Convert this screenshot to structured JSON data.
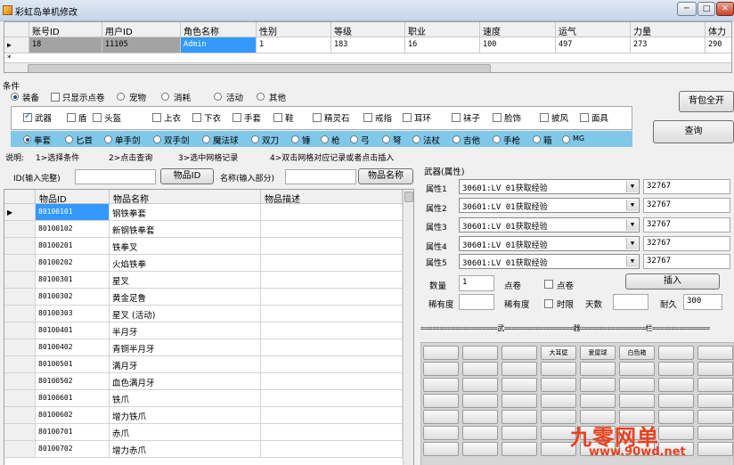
{
  "window": {
    "title": "彩虹岛单机修改",
    "min_glyph": "─",
    "max_glyph": "□",
    "close_glyph": "✕"
  },
  "top_grid": {
    "columns": [
      "账号ID",
      "用户ID",
      "角色名称",
      "性别",
      "等级",
      "职业",
      "速度",
      "运气",
      "力量",
      "体力"
    ],
    "row": [
      "18",
      "11105",
      "Admin",
      "1",
      "183",
      "16",
      "100",
      "497",
      "273",
      "290"
    ],
    "new_row_marker": "*",
    "current_row_marker": "▶"
  },
  "conditions": {
    "group_label": "条件",
    "radios": [
      {
        "label": "装备",
        "checked": true
      },
      {
        "label": "宠物",
        "checked": false
      },
      {
        "label": "消耗",
        "checked": false
      },
      {
        "label": "活动",
        "checked": false
      },
      {
        "label": "其他",
        "checked": false
      }
    ],
    "only_scroll": {
      "label": "只显示点卷",
      "checked": false
    },
    "equip_types": [
      {
        "label": "武器",
        "checked": true
      },
      {
        "label": "盾",
        "checked": false
      },
      {
        "label": "头盔",
        "checked": false
      },
      {
        "label": "上衣",
        "checked": false
      },
      {
        "label": "下衣",
        "checked": false
      },
      {
        "label": "手套",
        "checked": false
      },
      {
        "label": "鞋",
        "checked": false
      },
      {
        "label": "精灵石",
        "checked": false
      },
      {
        "label": "戒指",
        "checked": false
      },
      {
        "label": "耳环",
        "checked": false
      },
      {
        "label": "袜子",
        "checked": false
      },
      {
        "label": "脸饰",
        "checked": false
      },
      {
        "label": "披风",
        "checked": false
      },
      {
        "label": "面具",
        "checked": false
      }
    ],
    "weapon_types": [
      {
        "label": "拳套",
        "checked": true
      },
      {
        "label": "匕首",
        "checked": false
      },
      {
        "label": "单手剑",
        "checked": false
      },
      {
        "label": "双手剑",
        "checked": false
      },
      {
        "label": "魔法球",
        "checked": false
      },
      {
        "label": "双刀",
        "checked": false
      },
      {
        "label": "锤",
        "checked": false
      },
      {
        "label": "枪",
        "checked": false
      },
      {
        "label": "弓",
        "checked": false
      },
      {
        "label": "弩",
        "checked": false
      },
      {
        "label": "法杖",
        "checked": false
      },
      {
        "label": "吉他",
        "checked": false
      },
      {
        "label": "手枪",
        "checked": false
      },
      {
        "label": "箱",
        "checked": false
      },
      {
        "label": "MG",
        "checked": false
      }
    ],
    "unlock_bag_label": "背包全开",
    "query_label": "查询"
  },
  "instructions": {
    "label": "说明:",
    "step1": "1>选择条件",
    "step2": "2>点击查询",
    "step3": "3>选中网格记录",
    "step4": "4>双击网格对应记录或者点击插入"
  },
  "search": {
    "id_label": "ID(输入完整)",
    "id_value": "",
    "id_button": "物品ID",
    "name_label": "名称(输入部分)",
    "name_value": "",
    "name_button": "物品名称"
  },
  "item_grid": {
    "columns": [
      "物品ID",
      "物品名称",
      "物品描述"
    ],
    "rows": [
      {
        "id": "80100101",
        "name": "钢铁拳套",
        "desc": ""
      },
      {
        "id": "80100102",
        "name": "新钢铁拳套",
        "desc": ""
      },
      {
        "id": "80100201",
        "name": "铁拳叉",
        "desc": ""
      },
      {
        "id": "80100202",
        "name": "火焰铁拳",
        "desc": ""
      },
      {
        "id": "80100301",
        "name": "星叉",
        "desc": ""
      },
      {
        "id": "80100302",
        "name": "黄金足鲁",
        "desc": ""
      },
      {
        "id": "80100303",
        "name": "星叉 (活动)",
        "desc": ""
      },
      {
        "id": "80100401",
        "name": "半月牙",
        "desc": ""
      },
      {
        "id": "80100402",
        "name": "青铜半月牙",
        "desc": ""
      },
      {
        "id": "80100501",
        "name": "满月牙",
        "desc": ""
      },
      {
        "id": "80100502",
        "name": "血色满月牙",
        "desc": ""
      },
      {
        "id": "80100601",
        "name": "铁爪",
        "desc": ""
      },
      {
        "id": "80100602",
        "name": "增力铁爪",
        "desc": ""
      },
      {
        "id": "80100701",
        "name": "赤爪",
        "desc": ""
      },
      {
        "id": "80100702",
        "name": "增力赤爪",
        "desc": ""
      }
    ],
    "current_row_marker": "▶"
  },
  "weapon": {
    "group_label": "武器(属性)",
    "attributes": [
      {
        "label": "属性1",
        "select": "30601:LV 01获取经验",
        "value": "32767"
      },
      {
        "label": "属性2",
        "select": "30601:LV 01获取经验",
        "value": "32767"
      },
      {
        "label": "属性3",
        "select": "30601:LV 01获取经验",
        "value": "32767"
      },
      {
        "label": "属性4",
        "select": "30601:LV 01获取经验",
        "value": "32767"
      },
      {
        "label": "属性5",
        "select": "30601:LV 01获取经验",
        "value": "32767"
      }
    ],
    "quantity_label": "数量",
    "quantity_value": "1",
    "scroll_label": "点卷",
    "scroll_check_label": "点卷",
    "insert_label": "插入",
    "rarity_label": "稀有度",
    "rarity_value": "",
    "rarity2_label": "稀有度",
    "timelimit_label": "时限",
    "days_label": "天数",
    "days_value": "",
    "durability_label": "耐久",
    "durability_value": "300"
  },
  "equip_panel": {
    "header": "====================武==================器=================栏===============",
    "slot_labels": [
      "大耳壁",
      "爱屋球",
      "白色箱"
    ]
  },
  "watermark": {
    "text": "九零网单",
    "url": "www.90wd.net"
  },
  "colors": {
    "selected_cell": "#3399ff",
    "gray_cell": "#a3a3a3",
    "weapon_band": "#80c8e8",
    "watermark": "#e8421f"
  }
}
